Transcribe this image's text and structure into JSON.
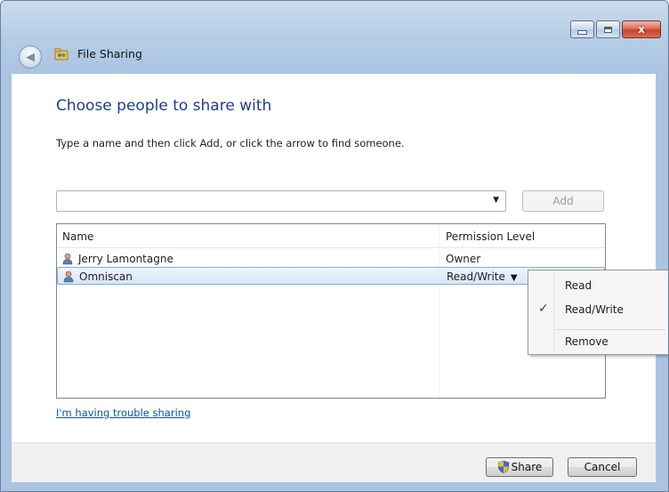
{
  "window": {
    "title": "File Sharing",
    "controls": {
      "minimize": "minimize",
      "maximize": "maximize",
      "close": "x"
    }
  },
  "main": {
    "heading": "Choose people to share with",
    "instructions": "Type a name and then click Add, or click the arrow to find someone.",
    "name_input": {
      "value": "",
      "placeholder": ""
    },
    "add_button": "Add",
    "list": {
      "columns": [
        "Name",
        "Permission Level"
      ],
      "rows": [
        {
          "name": "Jerry Lamontagne",
          "permission": "Owner"
        },
        {
          "name": "Omniscan",
          "permission": "Read/Write"
        }
      ]
    },
    "permission_menu": {
      "items": [
        {
          "label": "Read",
          "checked": false
        },
        {
          "label": "Read/Write",
          "checked": true
        },
        {
          "label": "Remove",
          "checked": false
        }
      ]
    },
    "trouble_link": "I'm having trouble sharing"
  },
  "footer": {
    "share_button": "Share",
    "cancel_button": "Cancel"
  },
  "icons": {
    "back": "back-arrow-icon",
    "app": "file-sharing-icon",
    "user": "user-icon",
    "shield": "uac-shield-icon",
    "check": "checkmark-icon"
  },
  "colors": {
    "heading": "#1e3d8f",
    "link": "#0a54a8",
    "close_button": "#c7432c"
  }
}
